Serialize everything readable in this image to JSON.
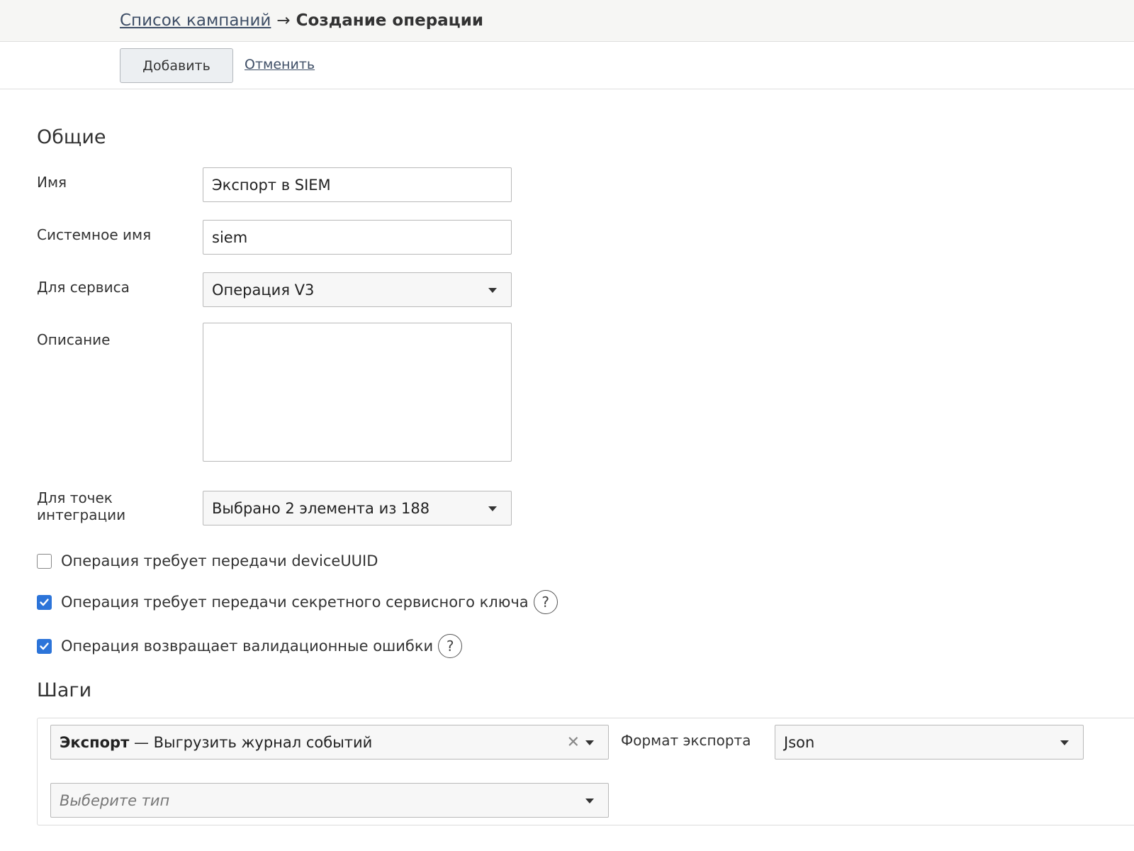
{
  "breadcrumb": {
    "parent_label": "Список кампаний",
    "separator": "→",
    "current_label": "Создание операции"
  },
  "toolbar": {
    "add_label": "Добавить",
    "cancel_label": "Отменить"
  },
  "general": {
    "title": "Общие",
    "name": {
      "label": "Имя",
      "value": "Экспорт в SIEM"
    },
    "system_name": {
      "label": "Системное имя",
      "value": "siem"
    },
    "service": {
      "label": "Для сервиса",
      "value": "Операция V3"
    },
    "description": {
      "label": "Описание",
      "value": ""
    },
    "integration_points": {
      "label": "Для точек интеграции",
      "value": "Выбрано 2 элемента из 188"
    }
  },
  "options": [
    {
      "label": "Операция требует передачи deviceUUID",
      "checked": false,
      "help": false
    },
    {
      "label": "Операция требует передачи секретного сервисного ключа",
      "checked": true,
      "help": true
    },
    {
      "label": "Операция возвращает валидационные ошибки",
      "checked": true,
      "help": true
    }
  ],
  "help_glyph": "?",
  "steps": {
    "title": "Шаги",
    "step1": {
      "name_bold": "Экспорт",
      "name_rest": " — Выгрузить журнал событий",
      "clear_glyph": "✕",
      "format_label": "Формат экспорта",
      "format_value": "Json"
    },
    "new_step": {
      "placeholder": "Выберите тип"
    }
  },
  "colors": {
    "accent": "#2c74d9",
    "link": "#3e4e66",
    "header_bg": "#f6f6f4"
  }
}
